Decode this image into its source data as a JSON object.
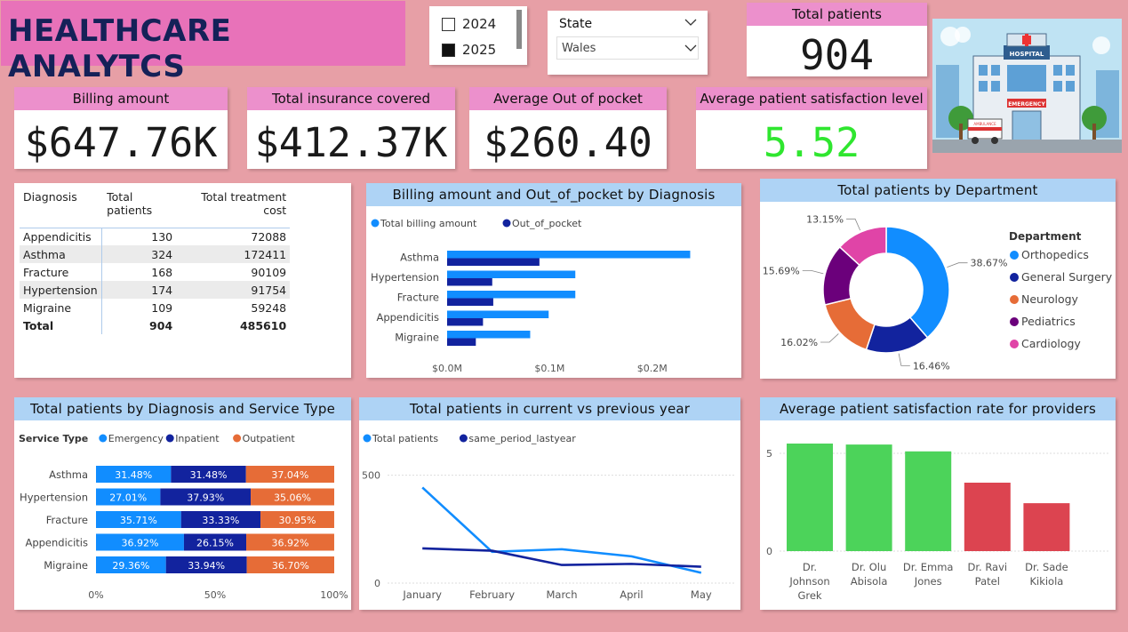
{
  "title": "HEALTHCARE ANALYTCS",
  "year_slicer": [
    {
      "label": "2024",
      "checked": false
    },
    {
      "label": "2025",
      "checked": true
    }
  ],
  "state_slicer": {
    "label": "State",
    "value": "Wales"
  },
  "kpis": {
    "total_patients": {
      "label": "Total patients",
      "value": "904"
    },
    "billing_amount": {
      "label": "Billing amount",
      "value": "$647.76K"
    },
    "insurance": {
      "label": "Total insurance covered",
      "value": "$412.37K"
    },
    "out_of_pocket": {
      "label": "Average Out of pocket",
      "value": "$260.40"
    },
    "satisfaction": {
      "label": "Average patient satisfaction level",
      "value": "5.52",
      "color": "#2fe62f"
    }
  },
  "image_words": {
    "hospital": "HOSPITAL",
    "emergency": "EMERGENCY",
    "ambulance": "AMBULANCE"
  },
  "diagnosis_table": {
    "headers": [
      "Diagnosis",
      "Total patients",
      "Total treatment cost"
    ],
    "rows": [
      [
        "Appendicitis",
        "130",
        "72088"
      ],
      [
        "Asthma",
        "324",
        "172411"
      ],
      [
        "Fracture",
        "168",
        "90109"
      ],
      [
        "Hypertension",
        "174",
        "91754"
      ],
      [
        "Migraine",
        "109",
        "59248"
      ]
    ],
    "total": [
      "Total",
      "904",
      "485610"
    ]
  },
  "colors": {
    "light_blue": "#118dff",
    "dark_blue": "#12239e",
    "orange": "#e66c37",
    "purple": "#6b007b",
    "pink": "#e044a7",
    "green": "#4cd35a",
    "red": "#dc4450",
    "header_pink": "#ec90cc",
    "header_blue": "#aed3f5",
    "title_navy": "#152158"
  },
  "chart_data": [
    {
      "id": "billing",
      "type": "bar",
      "orientation": "horizontal",
      "title": "Billing amount and Out_of_pocket by Diagnosis",
      "categories": [
        "Asthma",
        "Hypertension",
        "Fracture",
        "Appendicitis",
        "Migraine"
      ],
      "series": [
        {
          "name": "Total billing amount",
          "values": [
            0.237,
            0.125,
            0.125,
            0.099,
            0.081
          ]
        },
        {
          "name": "Out_of_pocket",
          "values": [
            0.09,
            0.044,
            0.045,
            0.035,
            0.028
          ]
        }
      ],
      "xticks": [
        "$0.0M",
        "$0.1M",
        "$0.2M"
      ],
      "xlim": [
        0,
        0.26
      ],
      "legend": "top-left"
    },
    {
      "id": "department",
      "type": "pie",
      "subtype": "donut",
      "title": "Total patients by Department",
      "legend_title": "Department",
      "labels": [
        "Orthopedics",
        "General Surgery",
        "Neurology",
        "Pediatrics",
        "Cardiology"
      ],
      "values": [
        38.67,
        16.46,
        16.02,
        15.69,
        13.15
      ],
      "value_labels": [
        "38.67%",
        "16.46%",
        "16.02%",
        "15.69%",
        "13.15%"
      ],
      "legend": "right"
    },
    {
      "id": "service",
      "type": "bar",
      "orientation": "horizontal",
      "stacked": "100%",
      "title": "Total patients by Diagnosis and Service Type",
      "legend_title": "Service Type",
      "categories": [
        "Asthma",
        "Hypertension",
        "Fracture",
        "Appendicitis",
        "Migraine"
      ],
      "series": [
        {
          "name": "Emergency",
          "values": [
            31.48,
            27.01,
            35.71,
            36.92,
            29.36
          ],
          "labels": [
            "31.48%",
            "27.01%",
            "35.71%",
            "36.92%",
            "29.36%"
          ]
        },
        {
          "name": "Inpatient",
          "values": [
            31.48,
            37.93,
            33.33,
            26.15,
            33.94
          ],
          "labels": [
            "31.48%",
            "37.93%",
            "33.33%",
            "26.15%",
            "33.94%"
          ]
        },
        {
          "name": "Outpatient",
          "values": [
            37.04,
            35.06,
            30.95,
            36.92,
            36.7
          ],
          "labels": [
            "37.04%",
            "35.06%",
            "30.95%",
            "36.92%",
            "36.70%"
          ]
        }
      ],
      "xticks": [
        "0%",
        "50%",
        "100%"
      ],
      "xlim": [
        0,
        100
      ],
      "legend": "top-left"
    },
    {
      "id": "yoy",
      "type": "line",
      "title": "Total patients in current vs previous year",
      "x": [
        "January",
        "February",
        "March",
        "April",
        "May"
      ],
      "series": [
        {
          "name": "Total patients",
          "values": [
            443,
            145,
            157,
            124,
            48
          ]
        },
        {
          "name": "same_period_lastyear",
          "values": [
            161,
            150,
            84,
            89,
            76
          ]
        }
      ],
      "yticks": [
        "0",
        "500"
      ],
      "ylim": [
        0,
        560
      ],
      "grid": true,
      "legend": "top-left"
    },
    {
      "id": "providers",
      "type": "bar",
      "title": "Average patient satisfaction rate for providers",
      "categories": [
        [
          "Dr.",
          "Johnson",
          "Grek"
        ],
        [
          "Dr. Olu",
          "Abisola"
        ],
        [
          "Dr. Emma",
          "Jones"
        ],
        [
          "Dr. Ravi",
          "Patel"
        ],
        [
          "Dr. Sade",
          "Kikiola"
        ]
      ],
      "values": [
        5.5,
        5.45,
        5.1,
        3.5,
        2.45
      ],
      "bar_colors": [
        "#4cd35a",
        "#4cd35a",
        "#4cd35a",
        "#dc4450",
        "#dc4450"
      ],
      "yticks": [
        "0",
        "5"
      ],
      "ylim": [
        0,
        6.0
      ],
      "grid": true
    }
  ]
}
